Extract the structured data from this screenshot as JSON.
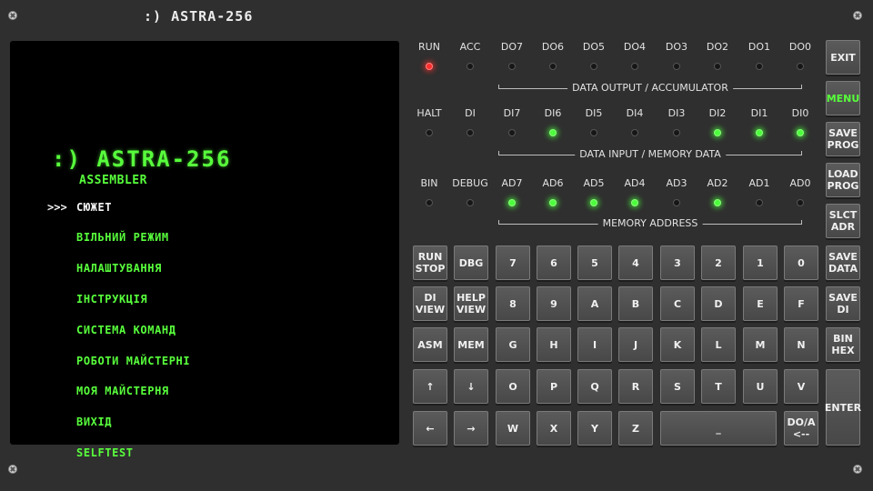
{
  "header": {
    "title": ":) ASTRA-256"
  },
  "screen": {
    "logo": ":) ASTRA-256",
    "subtitle": "ASSEMBLER",
    "cursor": ">>>",
    "menu": [
      "СЮЖЕТ",
      "ВІЛЬНИЙ РЕЖИМ",
      "НАЛАШТУВАННЯ",
      "ІНСТРУКЦІЯ",
      "СИСТЕМА КОМАНД",
      "РОБОТИ МАЙСТЕРНІ",
      "МОЯ МАЙСТЕРНЯ",
      "ВИХІД",
      "SELFTEST"
    ],
    "selected_index": 0,
    "colors": {
      "text": "#58ff3c",
      "selected": "#f2f2f2",
      "background": "#000000"
    }
  },
  "panel": {
    "rows": [
      {
        "group": "DATA OUTPUT / ACCUMULATOR",
        "leds": [
          {
            "label": "RUN",
            "state": "red"
          },
          {
            "label": "ACC",
            "state": "off"
          },
          {
            "label": "DO7",
            "state": "off"
          },
          {
            "label": "DO6",
            "state": "off"
          },
          {
            "label": "DO5",
            "state": "off"
          },
          {
            "label": "DO4",
            "state": "off"
          },
          {
            "label": "DO3",
            "state": "off"
          },
          {
            "label": "DO2",
            "state": "off"
          },
          {
            "label": "DO1",
            "state": "off"
          },
          {
            "label": "DO0",
            "state": "off"
          }
        ]
      },
      {
        "group": "DATA INPUT  / MEMORY DATA",
        "leds": [
          {
            "label": "HALT",
            "state": "off"
          },
          {
            "label": "DI",
            "state": "off"
          },
          {
            "label": "DI7",
            "state": "off"
          },
          {
            "label": "DI6",
            "state": "green"
          },
          {
            "label": "DI5",
            "state": "off"
          },
          {
            "label": "DI4",
            "state": "off"
          },
          {
            "label": "DI3",
            "state": "off"
          },
          {
            "label": "DI2",
            "state": "green"
          },
          {
            "label": "DI1",
            "state": "green"
          },
          {
            "label": "DI0",
            "state": "green"
          }
        ]
      },
      {
        "group": "MEMORY ADDRESS",
        "leds": [
          {
            "label": "BIN",
            "state": "off"
          },
          {
            "label": "DEBUG",
            "state": "off"
          },
          {
            "label": "AD7",
            "state": "green"
          },
          {
            "label": "AD6",
            "state": "green"
          },
          {
            "label": "AD5",
            "state": "green"
          },
          {
            "label": "AD4",
            "state": "green"
          },
          {
            "label": "AD3",
            "state": "off"
          },
          {
            "label": "AD2",
            "state": "green"
          },
          {
            "label": "AD1",
            "state": "off"
          },
          {
            "label": "AD0",
            "state": "off"
          }
        ]
      }
    ],
    "side_keys": [
      "EXIT",
      "MENU",
      "SAVE\nPROG",
      "LOAD\nPROG",
      "SLCT\nADR",
      "SAVE\nDATA",
      "SAVE\nDI",
      "BIN\nHEX",
      "ENTER"
    ],
    "active_side_key": "MENU",
    "keypad": [
      [
        "RUN\nSTOP",
        "DBG",
        "7",
        "6",
        "5",
        "4",
        "3",
        "2",
        "1",
        "0"
      ],
      [
        "DI\nVIEW",
        "HELP\nVIEW",
        "8",
        "9",
        "A",
        "B",
        "C",
        "D",
        "E",
        "F"
      ],
      [
        "ASM",
        "MEM",
        "G",
        "H",
        "I",
        "J",
        "K",
        "L",
        "M",
        "N"
      ],
      [
        "↑",
        "↓",
        "O",
        "P",
        "Q",
        "R",
        "S",
        "T",
        "U",
        "V"
      ],
      [
        "←",
        "→",
        "W",
        "X",
        "Y",
        "Z",
        "_",
        "DO/A\n<--"
      ]
    ],
    "colors": {
      "led_green": "#4cff3c",
      "led_red": "#ff2d2d",
      "key_face": "#505050",
      "panel": "#2f2f2f"
    }
  }
}
